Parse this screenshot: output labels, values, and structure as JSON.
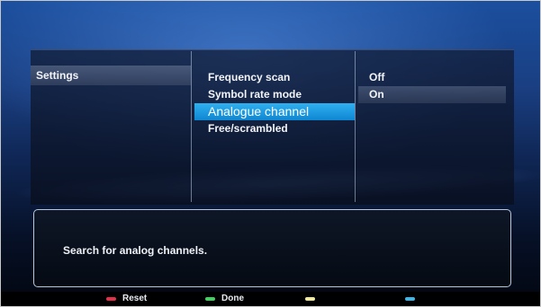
{
  "colors": {
    "background": "#1a3f82",
    "selection": "#1a9be3",
    "red_key": "#e5304a",
    "green_key": "#3ed35f",
    "yellow_key": "#f1ea9a",
    "blue_key": "#3ab8ea"
  },
  "settings_menu": {
    "section_label": "Settings"
  },
  "options": {
    "items": [
      {
        "label": "Frequency scan",
        "selected": false
      },
      {
        "label": "Symbol rate mode",
        "selected": false
      },
      {
        "label": "Analogue channel",
        "selected": true
      },
      {
        "label": "Free/scrambled",
        "selected": false
      }
    ]
  },
  "values": {
    "items": [
      {
        "label": "Off",
        "current": false
      },
      {
        "label": "On",
        "current": true
      }
    ]
  },
  "info": {
    "text": "Search for analog channels."
  },
  "color_keys": [
    {
      "label": "Reset",
      "color": "#e5304a",
      "icon": "red-key-icon"
    },
    {
      "label": "Done",
      "color": "#3ed35f",
      "icon": "green-key-icon"
    },
    {
      "label": "",
      "color": "#f1ea9a",
      "icon": "yellow-key-icon"
    },
    {
      "label": "",
      "color": "#3ab8ea",
      "icon": "blue-key-icon"
    }
  ]
}
